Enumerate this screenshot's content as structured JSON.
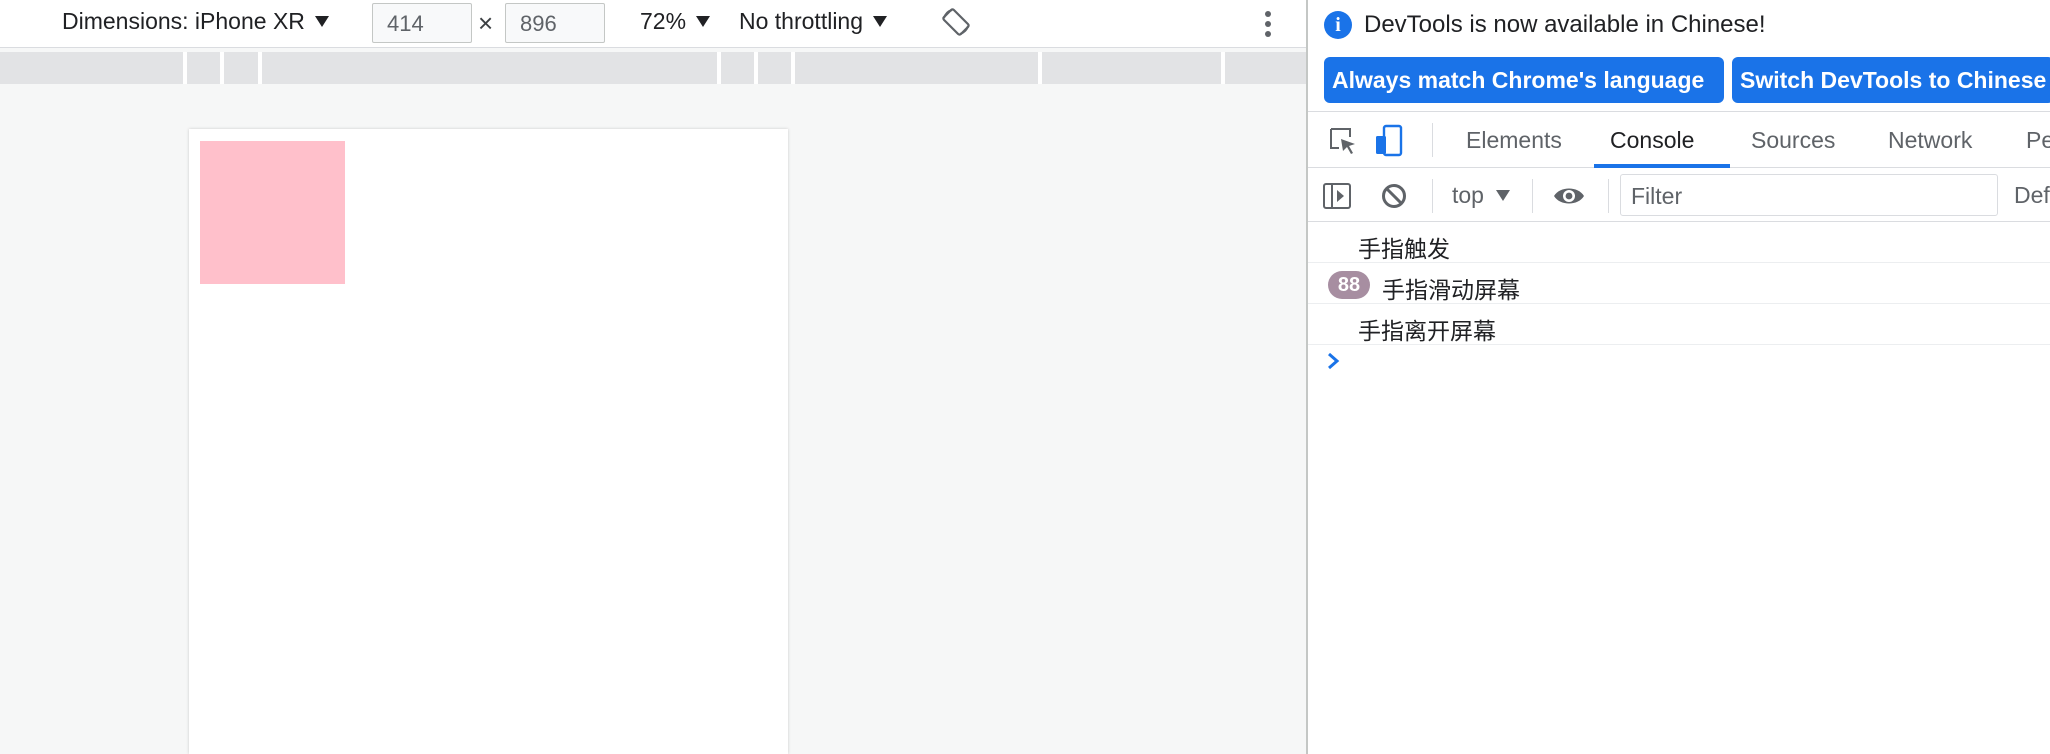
{
  "device_toolbar": {
    "dimensions_label": "Dimensions: iPhone XR",
    "width_value": "414",
    "height_value": "896",
    "times_symbol": "×",
    "zoom": "72%",
    "throttling": "No throttling",
    "rotate_icon": "rotate-icon",
    "more_icon": "more-vert-icon"
  },
  "page": {
    "box_color": "#ffc0cb"
  },
  "infobar": {
    "message": "DevTools is now available in Chinese!",
    "info_icon": "i",
    "match_button": "Always match Chrome's language",
    "switch_button": "Switch DevTools to Chinese"
  },
  "tabs": {
    "elements": "Elements",
    "console": "Console",
    "sources": "Sources",
    "network": "Network",
    "performance_partial": "Pe"
  },
  "console_toolbar": {
    "context": "top",
    "filter_placeholder": "Filter",
    "levels_partial": "Def"
  },
  "logs": [
    {
      "text": "手指触发",
      "count": ""
    },
    {
      "text": "手指滑动屏幕",
      "count": "88"
    },
    {
      "text": "手指离开屏幕",
      "count": ""
    }
  ],
  "colors": {
    "accent": "#1a73e8",
    "badge": "#a78ea1"
  }
}
